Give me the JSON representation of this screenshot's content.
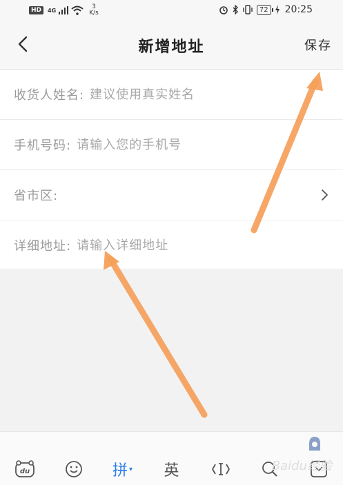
{
  "status_bar": {
    "hd": "HD",
    "network": "4G",
    "speed_value": "3",
    "speed_unit": "K/s",
    "battery": "72",
    "time": "20:25"
  },
  "header": {
    "title": "新增地址",
    "save_label": "保存"
  },
  "form": {
    "name_label": "收货人姓名:",
    "name_placeholder": "建议使用真实姓名",
    "phone_label": "手机号码:",
    "phone_placeholder": "请输入您的手机号",
    "region_label": "省市区:",
    "detail_label": "详细地址:",
    "detail_placeholder": "请输入详细地址"
  },
  "keyboard": {
    "pinyin_label": "拼",
    "english_label": "英"
  },
  "watermark": "Baidu经验",
  "colors": {
    "accent": "#2b7de9",
    "annotation_arrow": "#f5a05a"
  }
}
